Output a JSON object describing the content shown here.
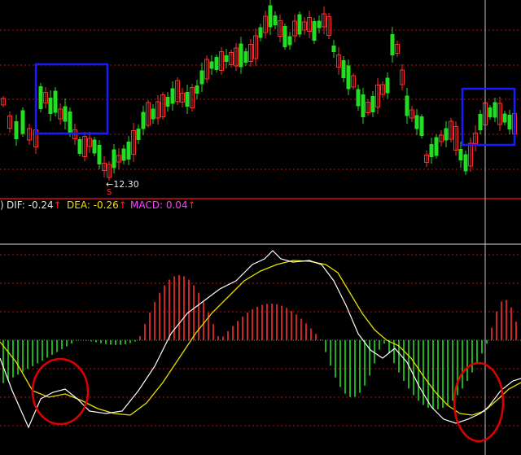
{
  "indicator": {
    "prefix": ")",
    "dif_label": "DIF: -0.24",
    "dea_label": "DEA: -0.26",
    "macd_label": "MACD: 0.04",
    "arrow": "↑"
  },
  "price_low": {
    "label": "12.30",
    "arrow": "←",
    "marker": "S"
  },
  "colors": {
    "background": "#000000",
    "up_candle": "#ff2a2a",
    "down_candle": "#22dd22",
    "grid": "#c01010",
    "dif": "#ffffff",
    "dea": "#e8e000",
    "macd_label": "#ff40ff",
    "highlight_box": "#1a1aff",
    "highlight_circle": "#e00000",
    "crosshair": "#c0c0c0"
  }
}
